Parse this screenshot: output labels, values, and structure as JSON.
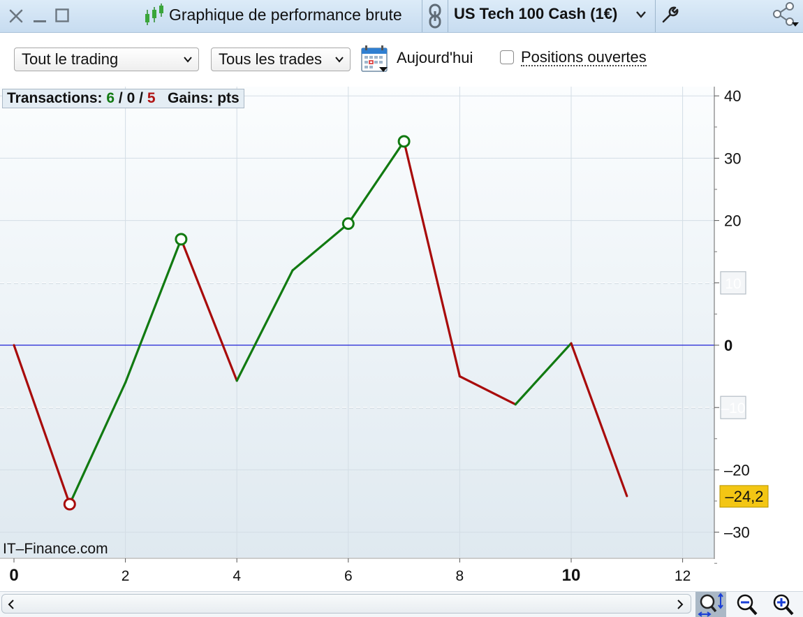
{
  "window": {
    "title": "Graphique de performance brute",
    "instrument": "US Tech 100 Cash (1€)"
  },
  "toolbar": {
    "scope_select": "Tout le trading",
    "trades_select": "Tous les trades",
    "today_label": "Aujourd'hui",
    "open_positions_label": "Positions ouvertes",
    "open_positions_checked": false
  },
  "stats": {
    "transactions_label": "Transactions:",
    "wins": "6",
    "sep1": "/",
    "neutral": "0",
    "sep2": "/",
    "losses": "5",
    "gains_label": "Gains:",
    "gains_unit": "pts"
  },
  "watermark": "IT–Finance.com",
  "icons": [
    "close-icon",
    "minimize-icon",
    "maximize-icon",
    "candlestick-icon",
    "link-icon",
    "chevron-down-icon",
    "wrench-icon",
    "share-icon",
    "calendar-icon",
    "scroll-left-icon",
    "scroll-right-icon",
    "zoom-fit-icon",
    "zoom-out-icon",
    "zoom-in-icon"
  ],
  "colors": {
    "gain": "#117a11",
    "loss": "#a80b0b",
    "zero_line": "#1f1fd6",
    "last_value_bg": "#f3c614",
    "titlebar": "#cfe2f3"
  },
  "chart_data": {
    "type": "line",
    "xlim": [
      0,
      13
    ],
    "ylim": [
      -34,
      41
    ],
    "x_ticks": [
      0,
      2,
      4,
      6,
      8,
      10,
      12
    ],
    "x_tick_labels": [
      "0",
      "2",
      "4",
      "6",
      "8",
      "10",
      "12"
    ],
    "bold_x_ticks": [
      0,
      10
    ],
    "y_ticks": [
      40,
      30,
      20,
      0,
      -20,
      -30
    ],
    "y_tick_labels": [
      "40",
      "30",
      "20",
      "0",
      "–20",
      "–30"
    ],
    "dashed_levels": [
      10,
      -10
    ],
    "dashed_level_labels": [
      "10",
      "–10"
    ],
    "last_value": -24.2,
    "last_value_label": "–24,2",
    "points": [
      {
        "x": 0,
        "y": 0
      },
      {
        "x": 1,
        "y": -25.5
      },
      {
        "x": 2,
        "y": -6
      },
      {
        "x": 3,
        "y": 17
      },
      {
        "x": 4,
        "y": -5.7
      },
      {
        "x": 5,
        "y": 12
      },
      {
        "x": 6,
        "y": 19.5
      },
      {
        "x": 7,
        "y": 32.7
      },
      {
        "x": 8,
        "y": -5
      },
      {
        "x": 9,
        "y": -9.5
      },
      {
        "x": 10,
        "y": 0.3
      },
      {
        "x": 11,
        "y": -24.2
      }
    ],
    "circled_points": [
      1,
      3,
      6,
      7
    ],
    "grid": true
  }
}
